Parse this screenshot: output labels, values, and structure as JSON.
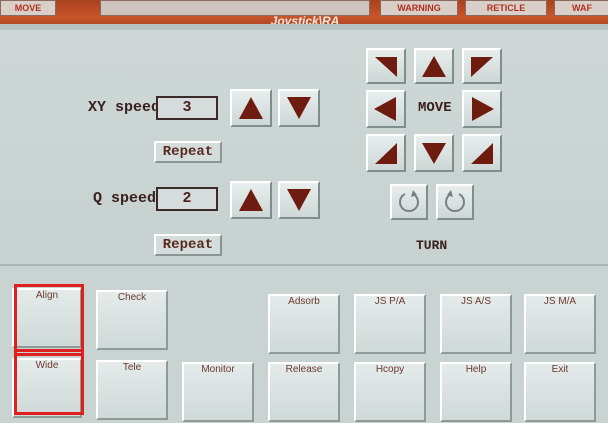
{
  "window": {
    "title": "Joystick\\RA"
  },
  "top_tabs": [
    "MOVE",
    "WARNING",
    "RETICLE",
    "WAF"
  ],
  "xy_speed": {
    "label": "XY speed",
    "value": "3",
    "repeat_label": "Repeat"
  },
  "q_speed": {
    "label": "Q speed",
    "value": "2",
    "repeat_label": "Repeat"
  },
  "move": {
    "label": "MOVE"
  },
  "turn": {
    "label": "TURN"
  },
  "function_buttons": {
    "align": "Align",
    "check": "Check",
    "adsorb": "Adsorb",
    "js_pia": "JS P/A",
    "js_as": "JS A/S",
    "js_ma": "JS M/A",
    "wide": "Wide",
    "tele": "Tele",
    "monitor": "Monitor",
    "release": "Release",
    "hcopy": "Hcopy",
    "help": "Help",
    "exit": "Exit"
  },
  "colors": {
    "accent": "#c9542a",
    "arrow": "#6e1c10",
    "highlight": "#e0201e"
  }
}
